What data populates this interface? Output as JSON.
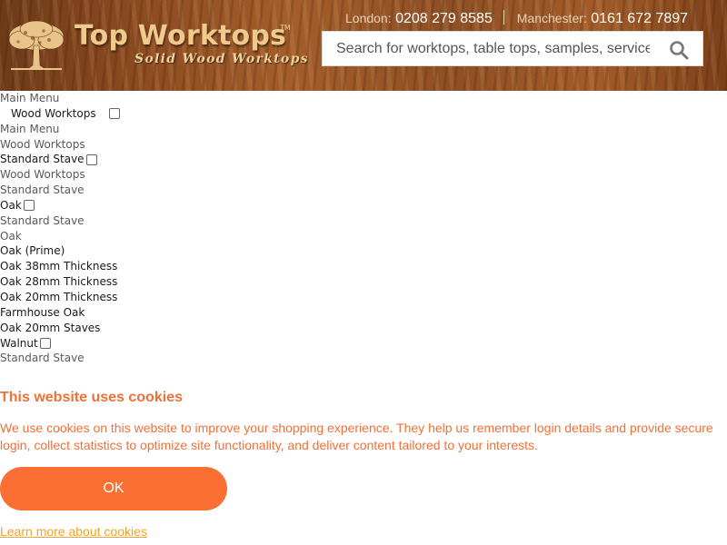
{
  "brand": {
    "name": "Top Worktops",
    "trademark": "TM",
    "tagline": "Solid Wood Worktops"
  },
  "contact": {
    "london_label": "London:",
    "london_number": "0208 279 8585",
    "manchester_label": "Manchester:",
    "manchester_number": "0161 672 7897"
  },
  "search": {
    "placeholder": "Search for worktops, table tops, samples, services...",
    "icon": "search-icon"
  },
  "menu": {
    "rows": [
      "Main Menu",
      "Wood Worktops",
      "Main Menu",
      "Wood Worktops",
      "Standard Stave",
      "Wood Worktops",
      "Standard Stave",
      "Oak",
      "Standard Stave",
      "Oak",
      "Oak (Prime)",
      "Oak 38mm Thickness",
      "Oak 28mm Thickness",
      "Oak 20mm Thickness",
      "Farmhouse Oak",
      "Oak 20mm Staves",
      "Walnut",
      "Standard Stave"
    ]
  },
  "cookie": {
    "title": "This website uses cookies",
    "text": "We use cookies on this website to improve your shopping experience. They help us remember login details and provide secure login, collect statistics to optimize site functionality, and deliver content tailored to your interests.",
    "ok_label": "OK",
    "learn_more": "Learn more about cookies"
  },
  "colors": {
    "accent": "#fb6f33",
    "cookie_text": "#f07138",
    "link": "#f4a325",
    "logo_gold": "#f0c98c",
    "header_wood": "#8a4a20"
  }
}
